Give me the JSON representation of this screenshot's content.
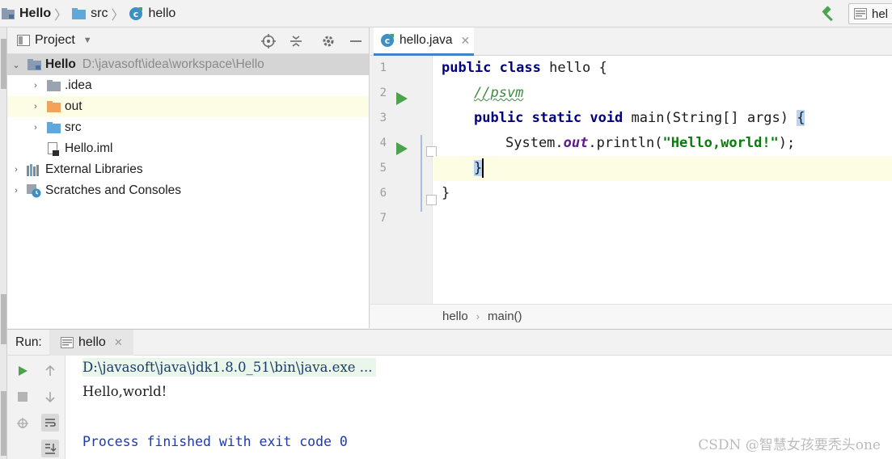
{
  "navbar": {
    "breadcrumbs": [
      {
        "label": "Hello",
        "icon": "module-folder-icon",
        "bold": true
      },
      {
        "label": "src",
        "icon": "source-folder-icon",
        "bold": false
      },
      {
        "label": "hello",
        "icon": "java-class-icon",
        "bold": false
      }
    ],
    "run_config_label": "hel"
  },
  "project_panel": {
    "title": "Project",
    "tree": [
      {
        "label": "Hello",
        "path": "D:\\javasoft\\idea\\workspace\\Hello",
        "level": 0,
        "expanded": true,
        "icon": "module-folder-icon"
      },
      {
        "label": ".idea",
        "level": 1,
        "expanded": false,
        "icon": "folder-icon"
      },
      {
        "label": "out",
        "level": 1,
        "expanded": false,
        "icon": "orange-folder-icon"
      },
      {
        "label": "src",
        "level": 1,
        "expanded": false,
        "icon": "source-folder-icon"
      },
      {
        "label": "Hello.iml",
        "level": 1,
        "icon": "iml-file-icon"
      },
      {
        "label": "External Libraries",
        "level": 0,
        "expanded": false,
        "icon": "libraries-icon"
      },
      {
        "label": "Scratches and Consoles",
        "level": 0,
        "expanded": false,
        "icon": "scratches-icon"
      }
    ]
  },
  "editor": {
    "tab_label": "hello.java",
    "line_numbers": [
      "1",
      "2",
      "3",
      "4",
      "5",
      "6",
      "7"
    ],
    "code": {
      "l1_kw1": "public",
      "l1_kw2": "class",
      "l1_rest": " hello {",
      "l2_comment": "//psvm",
      "l3_kw1": "public",
      "l3_kw2": "static",
      "l3_kw3": "void",
      "l3_rest": " main(String[] args) ",
      "l3_brace": "{",
      "l4_a": "System.",
      "l4_field": "out",
      "l4_b": ".println(",
      "l4_str": "\"Hello,world!\"",
      "l4_c": ");",
      "l5_brace": "}",
      "l6": "}"
    },
    "breadcrumb": [
      "hello",
      "main()"
    ]
  },
  "run_panel": {
    "label": "Run:",
    "tab_label": "hello",
    "console": {
      "command": "D:\\javasoft\\java\\jdk1.8.0_51\\bin\\java.exe ...",
      "output": "Hello,world!",
      "exit": "Process finished with exit code 0"
    }
  },
  "watermark": "CSDN @智慧女孩要秃头one",
  "colors": {
    "keyword": "#000080",
    "string": "#0a7b0a",
    "comment": "#3d8c3d",
    "run_green": "#4ba34c",
    "tab_underline": "#4083c9"
  }
}
